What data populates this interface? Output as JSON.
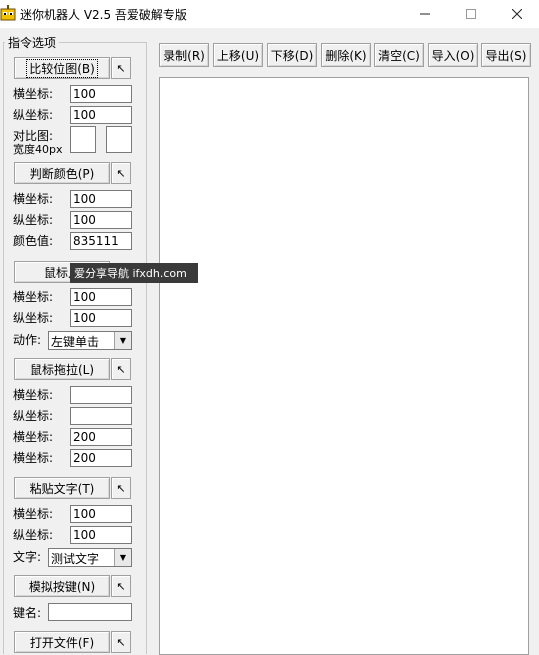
{
  "window": {
    "title": "迷你机器人 V2.5 吾爱破解专版",
    "min_icon": "minimize-icon",
    "max_icon": "maximize-icon",
    "close_icon": "close-icon"
  },
  "left_panel": {
    "group_title": "指令选项",
    "compare": {
      "button": "比较位图(B)",
      "x_label": "横坐标:",
      "x_value": "100",
      "y_label": "纵坐标:",
      "y_value": "100",
      "img_label_1": "对比图:",
      "img_label_2": "宽度40px"
    },
    "color": {
      "button": "判断颜色(P)",
      "x_label": "横坐标:",
      "x_value": "100",
      "y_label": "纵坐标:",
      "y_value": "100",
      "c_label": "颜色值:",
      "c_value": "835111"
    },
    "click": {
      "button": "鼠标点",
      "x_label": "横坐标:",
      "x_value": "100",
      "y_label": "纵坐标:",
      "y_value": "100",
      "action_label": "动作:",
      "action_value": "左键单击"
    },
    "drag": {
      "button": "鼠标拖拉(L)",
      "x1_label": "横坐标:",
      "x1_value": "",
      "y1_label": "纵坐标:",
      "y1_value": "",
      "x2_label": "横坐标:",
      "x2_value": "200",
      "y2_label": "横坐标:",
      "y2_value": "200"
    },
    "paste": {
      "button": "粘贴文字(T)",
      "x_label": "横坐标:",
      "x_value": "100",
      "y_label": "纵坐标:",
      "y_value": "100",
      "text_label": "文字:",
      "text_value": "测试文字"
    },
    "key": {
      "button": "模拟按键(N)",
      "key_label": "键名:",
      "key_value": ""
    },
    "open": {
      "button": "打开文件(F)"
    },
    "pick_glyph": "↖"
  },
  "toolbar": {
    "record": "录制(R)",
    "up": "上移(U)",
    "down": "下移(D)",
    "delete": "删除(K)",
    "clear": "清空(C)",
    "import": "导入(O)",
    "export": "导出(S)"
  },
  "watermark": "爱分享导航 ifxdh.com"
}
